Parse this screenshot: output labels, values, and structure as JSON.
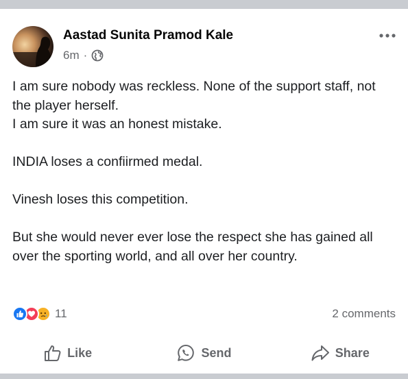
{
  "post": {
    "author": "Aastad Sunita Pramod Kale",
    "time": "6m",
    "separator": "·",
    "more_icon": "more-horizontal-icon",
    "paragraphs": [
      [
        "I am sure nobody was reckless. None of the support staff, not the player herself.",
        "I am sure it was an honest mistake."
      ],
      [
        "INDIA loses a confiirmed medal."
      ],
      [
        "Vinesh loses this competition."
      ],
      [
        "But she would never ever lose the respect she has gained all over the sporting world, and all over her country."
      ]
    ],
    "reaction_count": "11",
    "comments": "2 comments"
  },
  "reactions": [
    {
      "name": "like-reaction-icon",
      "color": "#1877f2"
    },
    {
      "name": "love-reaction-icon",
      "color": "#f33e58"
    },
    {
      "name": "sad-reaction-icon",
      "color": "#f7b125"
    }
  ],
  "actions": {
    "like": "Like",
    "send": "Send",
    "share": "Share"
  }
}
